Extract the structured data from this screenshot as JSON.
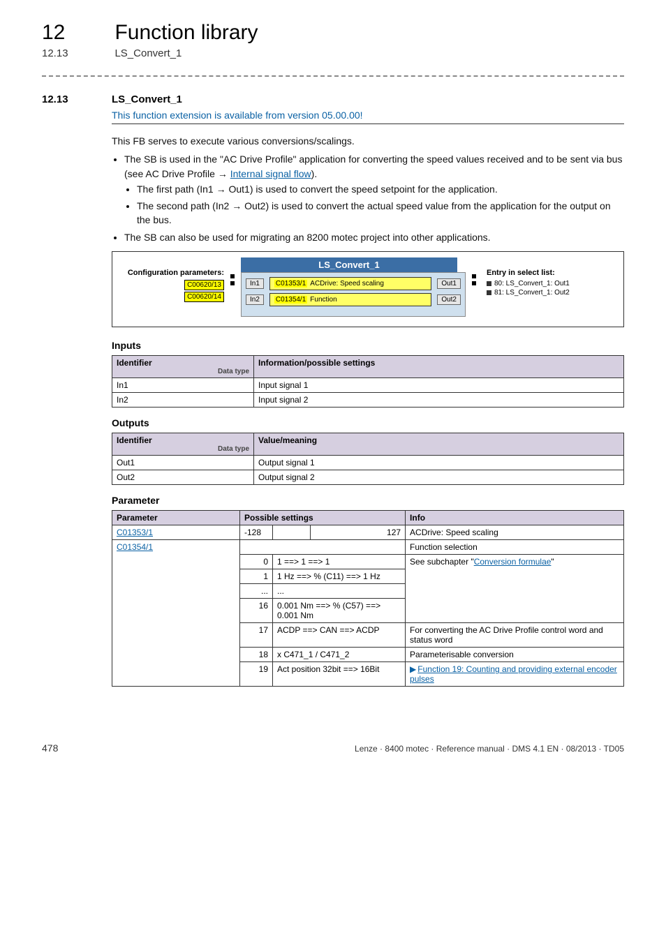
{
  "header": {
    "chapter_num": "12",
    "chapter_title": "Function library",
    "sub_num": "12.13",
    "sub_title": "LS_Convert_1"
  },
  "section": {
    "num": "12.13",
    "title": "LS_Convert_1",
    "availability": "This function extension is available from version 05.00.00!"
  },
  "desc": {
    "line1": "This FB serves to execute various conversions/scalings.",
    "b1a_pre": "The SB is used in the \"AC Drive Profile\" application for converting the speed values received and to be sent via bus (see AC Drive Profile",
    "b1a_arrow": " → ",
    "b1a_link": "Internal signal flow",
    "b1a_post": ").",
    "b2a": "The first path (In1 → Out1) is used to convert the speed setpoint for the application.",
    "b2b": "The second path (In2 → Out2) is used to convert the actual speed value from the application for the output on the bus.",
    "b1b": "The SB can also be used for migrating an 8200 motec project into other applications."
  },
  "diagram": {
    "title": "LS_Convert_1",
    "cfg_label": "Configuration parameters:",
    "cfg_c1": "C00620/13",
    "cfg_c2": "C00620/14",
    "in1": "In1",
    "in2": "In2",
    "out1": "Out1",
    "out2": "Out2",
    "p1_code": "C01353/1",
    "p1_text": "ACDrive: Speed scaling",
    "p2_code": "C01354/1",
    "p2_text": "Function",
    "entry_label": "Entry in select list:",
    "entry1": "80: LS_Convert_1: Out1",
    "entry2": "81: LS_Convert_1: Out2"
  },
  "inputs": {
    "heading": "Inputs",
    "col1": "Identifier",
    "col1_sub": "Data type",
    "col2": "Information/possible settings",
    "r1_id": "In1",
    "r1_info": "Input signal 1",
    "r2_id": "In2",
    "r2_info": "Input signal 2"
  },
  "outputs": {
    "heading": "Outputs",
    "col1": "Identifier",
    "col1_sub": "Data type",
    "col2": "Value/meaning",
    "r1_id": "Out1",
    "r1_info": "Output signal 1",
    "r2_id": "Out2",
    "r2_info": "Output signal 2"
  },
  "param": {
    "heading": "Parameter",
    "col_param": "Parameter",
    "col_possible": "Possible settings",
    "col_info": "Info",
    "r1_code": "C01353/1",
    "r1_min": "-128",
    "r1_max": "127",
    "r1_info": "ACDrive: Speed scaling",
    "r2_code": "C01354/1",
    "r2_info": "Function selection",
    "s0_n": "0",
    "s0_t": "1 ==> 1 ==> 1",
    "s1_n": "1",
    "s1_t": "1 Hz ==> % (C11) ==> 1 Hz",
    "sdots_n": "...",
    "sdots_t": "...",
    "s16_n": "16",
    "s16_t": "0.001 Nm ==> % (C57) ==> 0.001 Nm",
    "s17_n": "17",
    "s17_t": "ACDP ==> CAN ==> ACDP",
    "s17_info": "For converting the AC Drive Profile control word and status word",
    "s18_n": "18",
    "s18_t": "x C471_1 / C471_2",
    "s18_info": "Parameterisable conversion",
    "s19_n": "19",
    "s19_t": "Act position 32bit ==> 16Bit",
    "s19_link": "Function 19: Counting and providing external encoder pulses",
    "sub_see": "See subchapter \"",
    "sub_link": "Conversion formulae",
    "sub_close": "\""
  },
  "footer": {
    "page": "478",
    "line": "Lenze · 8400 motec · Reference manual · DMS 4.1 EN · 08/2013 · TD05"
  }
}
